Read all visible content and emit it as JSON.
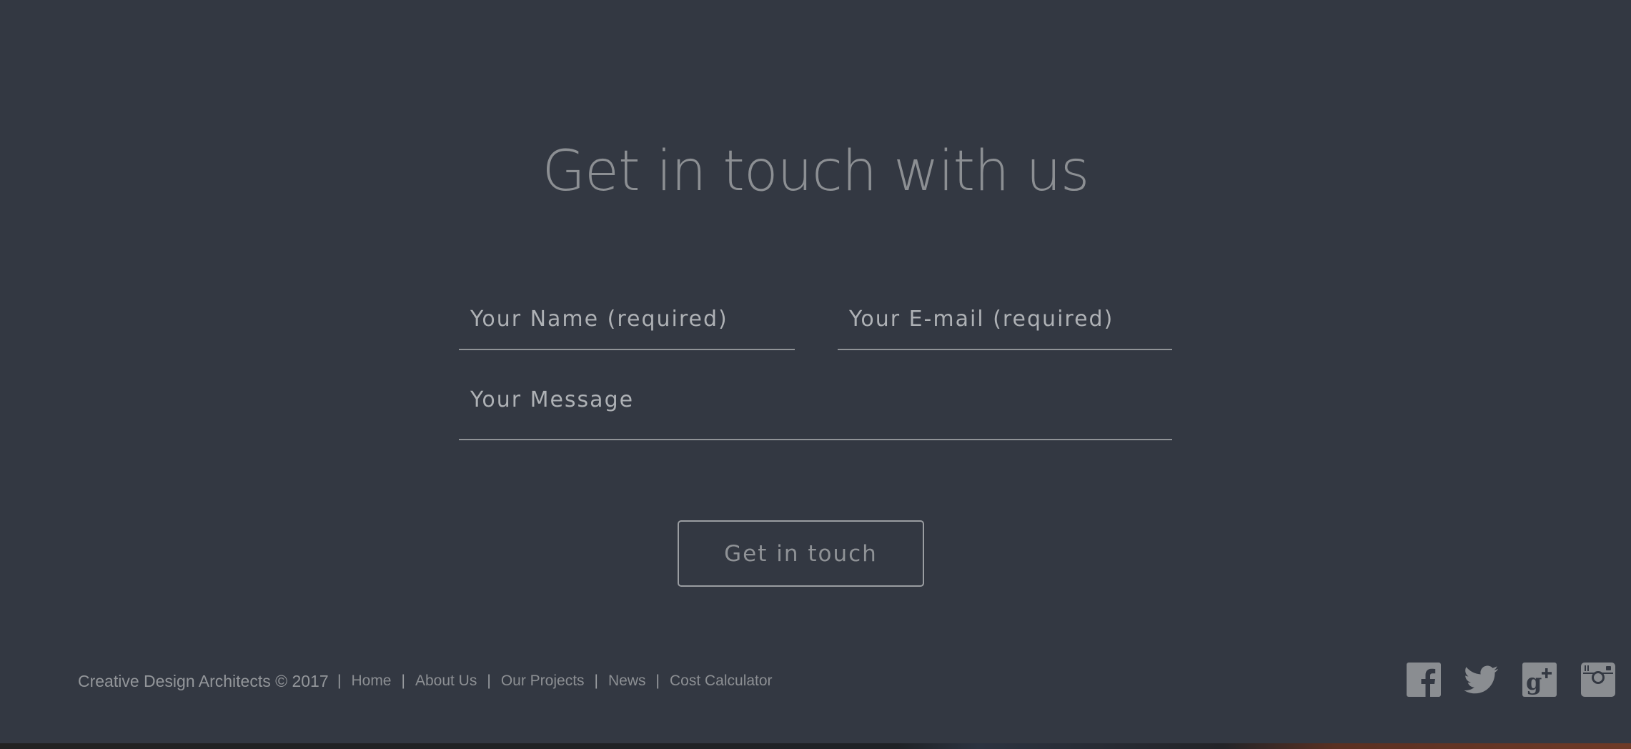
{
  "contact": {
    "title": "Get in touch with us",
    "name_placeholder": "Your Name (required)",
    "email_placeholder": "Your E-mail (required)",
    "message_placeholder": "Your Message",
    "submit_label": "Get in touch"
  },
  "footer": {
    "copyright": "Creative Design Architects © 2017",
    "separator": "|",
    "nav": [
      {
        "label": "Home"
      },
      {
        "label": "About Us"
      },
      {
        "label": "Our Projects"
      },
      {
        "label": "News"
      },
      {
        "label": "Cost Calculator"
      }
    ],
    "socials": [
      {
        "icon": "facebook-icon"
      },
      {
        "icon": "twitter-icon"
      },
      {
        "icon": "google-plus-icon"
      },
      {
        "icon": "instagram-icon"
      }
    ]
  },
  "colors": {
    "background": "#333842",
    "text_muted": "#8c8f93",
    "border": "#8f9296"
  }
}
